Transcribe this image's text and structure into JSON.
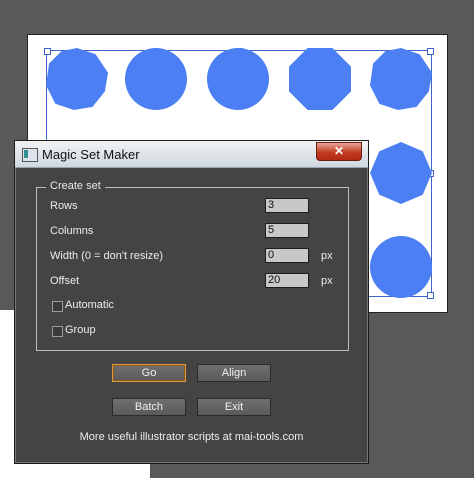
{
  "window": {
    "title": "Magic Set Maker",
    "close_label": "✕"
  },
  "group": {
    "title": "Create set",
    "rows_label": "Rows",
    "rows_value": "3",
    "columns_label": "Columns",
    "columns_value": "5",
    "width_label": "Width (0 = don't resize)",
    "width_value": "0",
    "width_unit": "px",
    "offset_label": "Offset",
    "offset_value": "20",
    "offset_unit": "px",
    "automatic_label": "Automatic",
    "automatic_checked": false,
    "group_label": "Group",
    "group_checked": false
  },
  "buttons": {
    "go": "Go",
    "align": "Align",
    "batch": "Batch",
    "exit": "Exit"
  },
  "footer": "More useful illustrator scripts at mai-tools.com",
  "colors": {
    "accent_shapes": "#4c7ff4",
    "dialog_bg": "#444444",
    "selection": "#3f63c8",
    "close": "#c23b22"
  }
}
